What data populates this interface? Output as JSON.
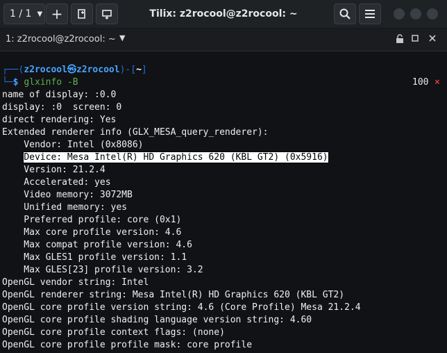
{
  "titlebar": {
    "session_label": "1 / 1",
    "title": "Tilix: z2rocool@z2rocool: ~"
  },
  "terminal_header": {
    "title": "1: z2rocool@z2rocool: ~"
  },
  "prompt": {
    "corner": "┌──(",
    "user": "z2rocool",
    "at": "㉿",
    "host": "z2rocool",
    "close": ")-[",
    "path": "~",
    "end": "]",
    "corner2": "└─",
    "symbol": "$",
    "command": "glxinfo -B",
    "exit_count": "100",
    "exit_mark": "×"
  },
  "output": [
    "name of display: :0.0",
    "display: :0  screen: 0",
    "direct rendering: Yes",
    "Extended renderer info (GLX_MESA_query_renderer):",
    "    Vendor: Intel (0x8086)",
    "    Device: Mesa Intel(R) HD Graphics 620 (KBL GT2) (0x5916)",
    "    Version: 21.2.4",
    "    Accelerated: yes",
    "    Video memory: 3072MB",
    "    Unified memory: yes",
    "    Preferred profile: core (0x1)",
    "    Max core profile version: 4.6",
    "    Max compat profile version: 4.6",
    "    Max GLES1 profile version: 1.1",
    "    Max GLES[23] profile version: 3.2",
    "OpenGL vendor string: Intel",
    "OpenGL renderer string: Mesa Intel(R) HD Graphics 620 (KBL GT2)",
    "OpenGL core profile version string: 4.6 (Core Profile) Mesa 21.2.4",
    "OpenGL core profile shading language version string: 4.60",
    "OpenGL core profile context flags: (none)",
    "OpenGL core profile profile mask: core profile"
  ],
  "icons": {
    "add": "plus-icon",
    "new_window": "new-window-icon",
    "sync": "sync-input-icon",
    "search": "search-icon",
    "menu": "hamburger-menu-icon",
    "read_only": "read-only-icon",
    "maximize": "maximize-icon",
    "close": "close-icon"
  }
}
